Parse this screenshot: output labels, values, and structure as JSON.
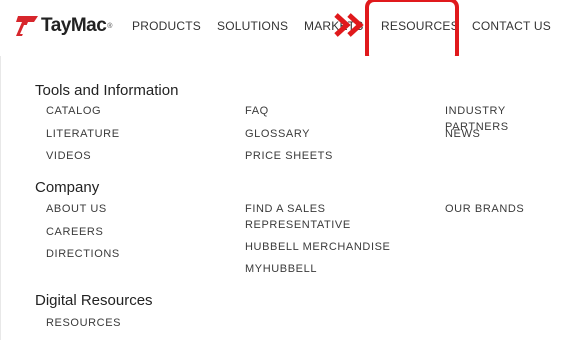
{
  "header": {
    "logo_text": "TayMac",
    "logo_reg": "®",
    "nav": [
      "PRODUCTS",
      "SOLUTIONS",
      "MARKETS",
      "RESOURCES",
      "CONTACT US"
    ]
  },
  "menu": {
    "sections": [
      {
        "title": "Tools and Information",
        "col1": [
          "CATALOG",
          "LITERATURE",
          "VIDEOS"
        ],
        "col2": [
          "FAQ",
          "GLOSSARY",
          "PRICE SHEETS"
        ],
        "col3": [
          "INDUSTRY PARTNERS",
          "NEWS"
        ]
      },
      {
        "title": "Company",
        "col1": [
          "ABOUT US",
          "CAREERS",
          "DIRECTIONS"
        ],
        "col2": [
          "FIND A SALES REPRESENTATIVE",
          "HUBBELL MERCHANDISE",
          "MYHUBBELL"
        ],
        "col3": [
          "OUR BRANDS"
        ]
      },
      {
        "title": "Digital Resources",
        "col1": [
          "RESOURCES"
        ]
      }
    ]
  },
  "colors": {
    "highlight": "#e0191c",
    "logo_red": "#d7262c"
  },
  "icons": {
    "arrow": "double-chevron-right-icon"
  }
}
